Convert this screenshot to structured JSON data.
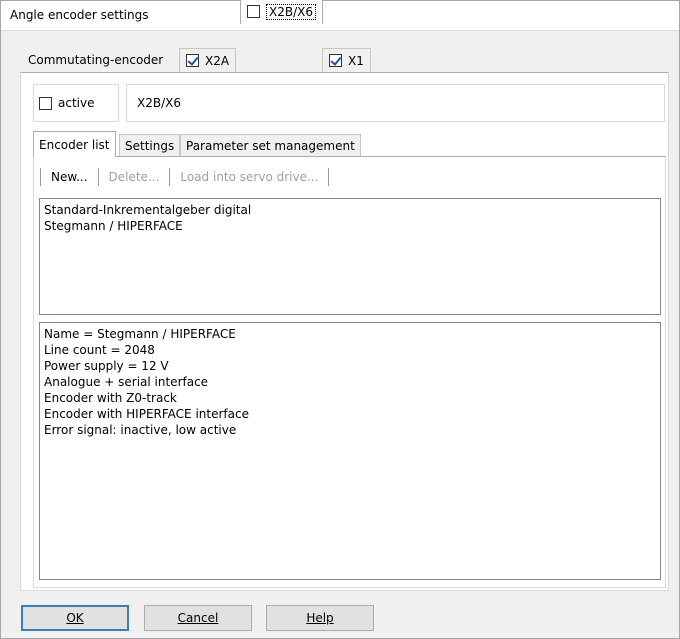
{
  "window": {
    "title": "Angle encoder settings"
  },
  "top_tabs": {
    "label": "Commutating-encoder",
    "items": [
      {
        "label": "X2A",
        "checked": true
      },
      {
        "label": "X2B/X6",
        "checked": false
      },
      {
        "label": "X1",
        "checked": true
      }
    ]
  },
  "active": {
    "label": "active",
    "checked": false
  },
  "selected_encoder": "X2B/X6",
  "inner_tabs": [
    {
      "label": "Encoder list"
    },
    {
      "label": "Settings"
    },
    {
      "label": "Parameter set management"
    }
  ],
  "toolbar": {
    "new_label": "New...",
    "delete_label": "Delete...",
    "load_label": "Load into servo drive..."
  },
  "encoder_list": [
    "Standard-Inkrementalgeber digital",
    "Stegmann / HIPERFACE"
  ],
  "details": [
    "Name = Stegmann / HIPERFACE",
    "Line count = 2048",
    "Power supply = 12 V",
    "Analogue + serial interface",
    "Encoder with Z0-track",
    "Encoder with HIPERFACE interface",
    "Error signal: inactive, low active"
  ],
  "buttons": {
    "ok_label": "OK",
    "cancel_label": "Cancel",
    "help_label": "Help"
  }
}
